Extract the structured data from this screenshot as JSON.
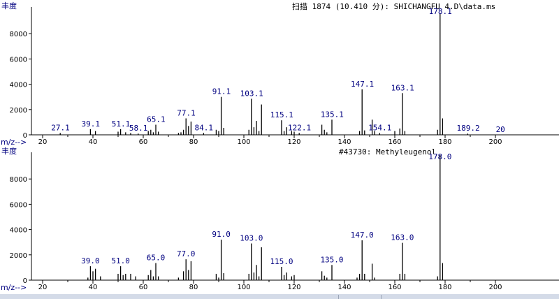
{
  "panels": [
    {
      "ylabel": "丰度",
      "xlabel": "m/z-->",
      "header": "扫描 1874 (10.410 分): SHICHANGFU 4.D\\data.ms"
    },
    {
      "ylabel": "丰度",
      "xlabel": "m/z-->",
      "header": "#43730: Methyleugenol"
    }
  ],
  "colors": {
    "bar": "#000000",
    "axis": "#000000",
    "peak_label": "#000080",
    "ylabel": "#000080"
  },
  "chart_data": [
    {
      "type": "bar",
      "title": "扫描 1874 (10.410 分): SHICHANGFU 4.D\\data.ms",
      "xlabel": "m/z-->",
      "ylabel": "丰度",
      "xlim": [
        15,
        203
      ],
      "ylim": [
        0,
        10000
      ],
      "xticks": [
        20,
        40,
        60,
        80,
        100,
        120,
        140,
        160,
        180,
        200
      ],
      "yticks": [
        0,
        2000,
        4000,
        6000,
        8000
      ],
      "x": [
        27,
        39,
        41,
        50,
        51,
        53,
        55,
        58,
        62,
        63,
        64,
        65,
        66,
        74,
        75,
        76,
        77,
        78,
        79,
        84,
        89,
        90,
        91,
        92,
        102,
        103,
        104,
        105,
        106,
        107,
        115,
        116,
        117,
        119,
        120,
        122,
        131,
        132,
        133,
        135,
        146,
        147,
        148,
        151,
        152,
        154,
        160,
        162,
        163,
        164,
        177,
        178,
        179,
        189
      ],
      "values": [
        150,
        450,
        300,
        250,
        450,
        200,
        150,
        100,
        300,
        400,
        200,
        800,
        250,
        150,
        200,
        400,
        1300,
        700,
        1050,
        150,
        400,
        300,
        3000,
        550,
        400,
        2850,
        600,
        1100,
        300,
        2400,
        1150,
        300,
        600,
        300,
        250,
        150,
        800,
        400,
        200,
        1200,
        300,
        3600,
        350,
        1200,
        300,
        150,
        300,
        500,
        3300,
        300,
        400,
        9600,
        1300,
        100
      ],
      "labels": [
        {
          "x": 27.1,
          "text": "27.1"
        },
        {
          "x": 39.1,
          "text": "39.1"
        },
        {
          "x": 51.1,
          "text": "51.1"
        },
        {
          "x": 58.1,
          "text": "58.1"
        },
        {
          "x": 65.1,
          "text": "65.1"
        },
        {
          "x": 77.1,
          "text": "77.1"
        },
        {
          "x": 84.1,
          "text": "84.1"
        },
        {
          "x": 91.1,
          "text": "91.1"
        },
        {
          "x": 103.1,
          "text": "103.1"
        },
        {
          "x": 115.1,
          "text": "115.1"
        },
        {
          "x": 122.1,
          "text": "122.1"
        },
        {
          "x": 135.1,
          "text": "135.1"
        },
        {
          "x": 147.1,
          "text": "147.1"
        },
        {
          "x": 154.1,
          "text": "154.1"
        },
        {
          "x": 163.1,
          "text": "163.1"
        },
        {
          "x": 178.1,
          "text": "178.1"
        },
        {
          "x": 189.2,
          "text": "189.2"
        },
        {
          "x": 202.0,
          "text": "20"
        }
      ]
    },
    {
      "type": "bar",
      "title": "#43730: Methyleugenol",
      "xlabel": "m/z-->",
      "ylabel": "丰度",
      "xlim": [
        15,
        203
      ],
      "ylim": [
        0,
        10000
      ],
      "xticks": [
        20,
        40,
        60,
        80,
        100,
        120,
        140,
        160,
        180,
        200
      ],
      "yticks": [
        0,
        2000,
        4000,
        6000,
        8000
      ],
      "x": [
        38,
        39,
        40,
        41,
        43,
        50,
        51,
        52,
        53,
        55,
        57,
        62,
        63,
        64,
        65,
        66,
        74,
        76,
        77,
        78,
        79,
        89,
        90,
        91,
        92,
        102,
        103,
        104,
        105,
        106,
        107,
        115,
        116,
        117,
        119,
        120,
        131,
        132,
        133,
        135,
        145,
        146,
        147,
        148,
        151,
        152,
        162,
        163,
        164,
        177,
        178,
        179
      ],
      "values": [
        200,
        1100,
        700,
        900,
        300,
        500,
        1100,
        400,
        500,
        500,
        300,
        400,
        800,
        300,
        1350,
        300,
        200,
        700,
        1650,
        800,
        1500,
        500,
        200,
        3200,
        550,
        500,
        2900,
        600,
        1200,
        300,
        2600,
        1050,
        400,
        600,
        300,
        400,
        700,
        350,
        200,
        1200,
        200,
        500,
        3150,
        500,
        1300,
        200,
        500,
        2950,
        500,
        300,
        9900,
        1350
      ],
      "labels": [
        {
          "x": 39.0,
          "text": "39.0"
        },
        {
          "x": 51.0,
          "text": "51.0"
        },
        {
          "x": 65.0,
          "text": "65.0"
        },
        {
          "x": 77.0,
          "text": "77.0"
        },
        {
          "x": 91.0,
          "text": "91.0"
        },
        {
          "x": 103.0,
          "text": "103.0"
        },
        {
          "x": 115.0,
          "text": "115.0"
        },
        {
          "x": 135.0,
          "text": "135.0"
        },
        {
          "x": 147.0,
          "text": "147.0"
        },
        {
          "x": 163.0,
          "text": "163.0"
        },
        {
          "x": 178.0,
          "text": "178.0"
        }
      ]
    }
  ]
}
